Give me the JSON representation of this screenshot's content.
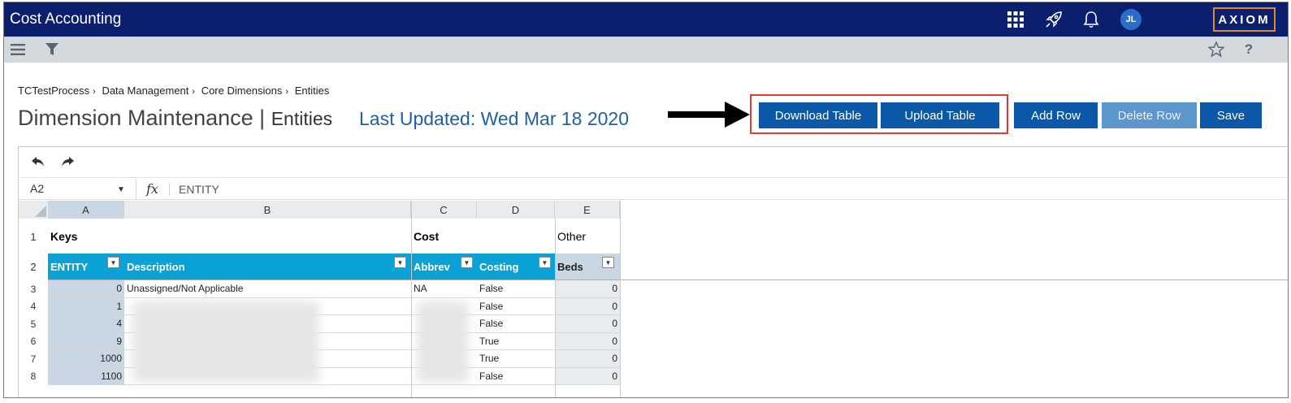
{
  "app": {
    "title": "Cost Accounting",
    "avatar": "JL",
    "logo": "AXIOM"
  },
  "icons": {
    "top": [
      "apps-grid-icon",
      "rocket-icon",
      "bell-icon"
    ],
    "toolbar": [
      "menu-icon",
      "filter-icon",
      "star-icon",
      "help-icon"
    ],
    "help_label": "?"
  },
  "breadcrumb": [
    "TCTestProcess",
    "Data Management",
    "Core Dimensions",
    "Entities"
  ],
  "page": {
    "title": "Dimension Maintenance |",
    "entity": "Entities",
    "last_updated": "Last Updated: Wed Mar 18 2020"
  },
  "buttons": {
    "download": "Download Table",
    "upload": "Upload Table",
    "add_row": "Add Row",
    "delete_row": "Delete Row",
    "save": "Save"
  },
  "sheet": {
    "cell_ref": "A2",
    "fx": "fx",
    "formula": "ENTITY",
    "columns": [
      "A",
      "B",
      "C",
      "D",
      "E"
    ],
    "group_headers": {
      "keys": "Keys",
      "cost": "Cost",
      "other": "Other"
    },
    "field_headers": {
      "entity": "ENTITY",
      "description": "Description",
      "abbrev": "Abbrev",
      "costing": "Costing",
      "beds": "Beds"
    },
    "rows": [
      {
        "num": "3",
        "entity": "0",
        "description": "Unassigned/Not Applicable",
        "abbrev": "NA",
        "costing": "False",
        "beds": "0"
      },
      {
        "num": "4",
        "entity": "1",
        "description": "",
        "abbrev": "",
        "costing": "False",
        "beds": "0"
      },
      {
        "num": "5",
        "entity": "4",
        "description": "",
        "abbrev": "",
        "costing": "False",
        "beds": "0"
      },
      {
        "num": "6",
        "entity": "9",
        "description": "",
        "abbrev": "",
        "costing": "True",
        "beds": "0"
      },
      {
        "num": "7",
        "entity": "1000",
        "description": "",
        "abbrev": "",
        "costing": "True",
        "beds": "0"
      },
      {
        "num": "8",
        "entity": "1100",
        "description": "",
        "abbrev": "",
        "costing": "False",
        "beds": "0"
      }
    ],
    "row_numbers": {
      "header1": "1",
      "header2": "2"
    }
  }
}
